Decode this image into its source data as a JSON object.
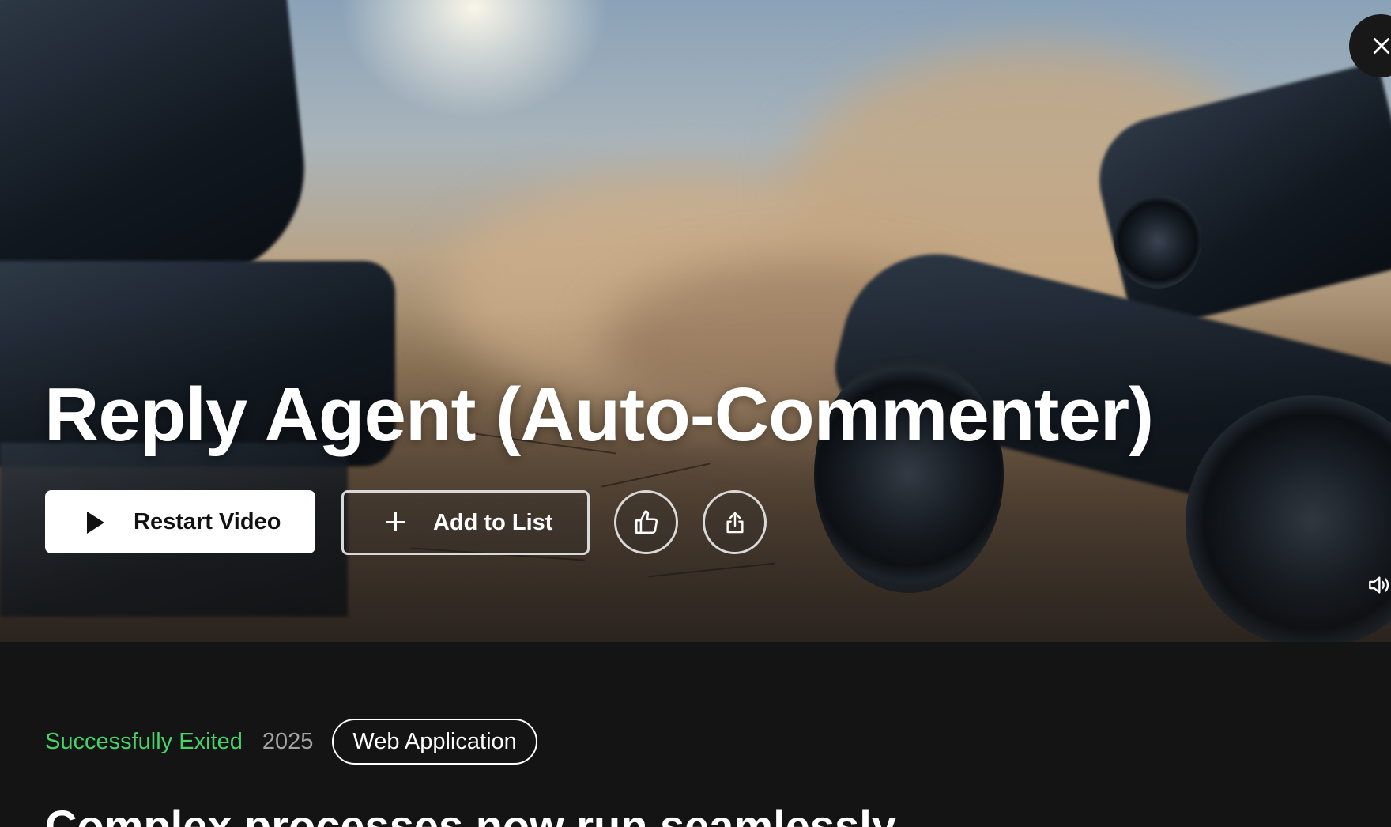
{
  "hero": {
    "title": "Reply Agent (Auto-Commenter)",
    "background_image": "desert-battle-vehicles-dust-cloud"
  },
  "actions": {
    "restart_label": "Restart Video",
    "restart_icon": "play-icon",
    "add_list_label": "Add to List",
    "add_list_icon": "plus-icon",
    "like_icon": "thumbs-up-icon",
    "share_icon": "share-icon"
  },
  "controls": {
    "close_icon": "close-icon",
    "volume_icon": "volume-icon"
  },
  "details": {
    "status": "Successfully Exited",
    "year": "2025",
    "category": "Web Application"
  },
  "description": {
    "headline": "Complex processes now run seamlessly"
  },
  "colors": {
    "background": "#141414",
    "status_green": "#46d369",
    "year_gray": "#a3a3a3",
    "primary_button": "#ffffff"
  }
}
